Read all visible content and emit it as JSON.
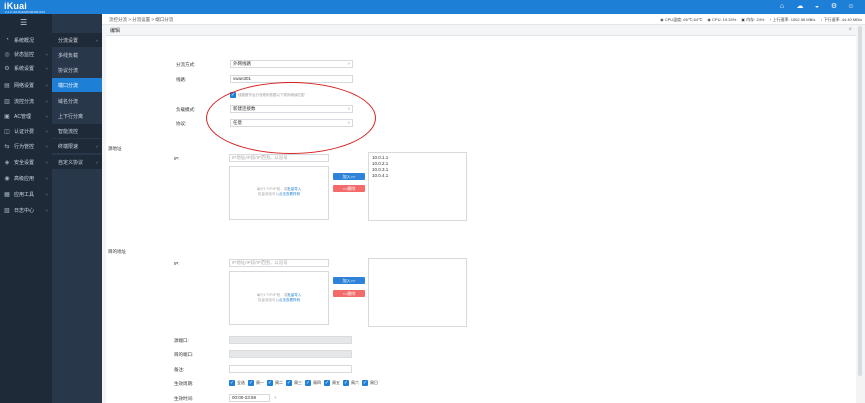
{
  "app": {
    "logo": "iKuai",
    "version": "3.4.2 x64 Build202009091019"
  },
  "topbar_icons": [
    "home-icon",
    "cloud-icon",
    "notification-icon",
    "settings-icon",
    "user-icon"
  ],
  "sidebar": {
    "items": [
      {
        "icon": "dashboard-icon",
        "glyph": "◔",
        "label": "系统概况"
      },
      {
        "icon": "monitor-icon",
        "glyph": "◎",
        "label": "状态监控",
        "chev": "˅"
      },
      {
        "icon": "gear-icon",
        "glyph": "⚙",
        "label": "系统设置",
        "chev": "˅"
      },
      {
        "icon": "network-icon",
        "glyph": "▤",
        "label": "网络设置",
        "chev": "˅"
      },
      {
        "icon": "traffic-icon",
        "glyph": "▥",
        "label": "流控分流",
        "chev": "˅"
      },
      {
        "icon": "ac-icon",
        "glyph": "▣",
        "label": "AC管理",
        "chev": "˅"
      },
      {
        "icon": "auth-icon",
        "glyph": "◫",
        "label": "认证计费",
        "chev": "˅"
      },
      {
        "icon": "behavior-icon",
        "glyph": "⇆",
        "label": "行为管控",
        "chev": "˅"
      },
      {
        "icon": "security-icon",
        "glyph": "◈",
        "label": "安全设置",
        "chev": "˅"
      },
      {
        "icon": "advanced-icon",
        "glyph": "◉",
        "label": "高级应用",
        "chev": "˅"
      },
      {
        "icon": "tools-icon",
        "glyph": "▦",
        "label": "应用工具",
        "chev": "˅"
      },
      {
        "icon": "log-icon",
        "glyph": "▧",
        "label": "日志中心",
        "chev": "˅"
      }
    ],
    "sub_items": [
      {
        "label": "分流设置",
        "type": "group",
        "chev": "˄"
      },
      {
        "label": "多线负载",
        "type": "normal"
      },
      {
        "label": "协议分流",
        "type": "normal"
      },
      {
        "label": "端口分流",
        "type": "active"
      },
      {
        "label": "域名分流",
        "type": "normal"
      },
      {
        "label": "上下行分离",
        "type": "normal"
      },
      {
        "label": "智能流控",
        "type": "group"
      },
      {
        "label": "终端限速",
        "type": "group",
        "chev": "˅"
      },
      {
        "label": "自定义协议",
        "type": "group",
        "chev": "˅"
      }
    ]
  },
  "header": {
    "breadcrumb": "流控分流 > 分流设置 > 端口分流",
    "stats": [
      {
        "icon": "cpu-temp-icon",
        "text": "CPU温度: 65℃,64℃"
      },
      {
        "icon": "cpu-icon",
        "text": "CPU: 19.33%"
      },
      {
        "icon": "memory-icon",
        "text": "内存: 24%"
      },
      {
        "icon": "upload-icon",
        "text": "上行速率: 1002.56 MB/s"
      },
      {
        "icon": "download-icon",
        "text": "下行速率: 44.40 MB/s"
      }
    ]
  },
  "panel": {
    "title": "编辑",
    "close": "×",
    "split_mode_label": "分流方式:",
    "split_mode_value": "外网线路",
    "line_label": "线路:",
    "line_value": "vwan301",
    "enable_hint": "线路断开后分流规则依据以下规则继续匹配",
    "load_mode_label": "负载模式:",
    "load_mode_value": "新建连接数",
    "protocol_label": "协议:",
    "protocol_value": "任意",
    "source_label": "源地址",
    "dest_label": "目的地址",
    "ip_label": "IP:",
    "ip_placeholder": "IP地址/IP段/IP范围，以逗号",
    "batch_hint_line1": "每行1个IP/IP段，或",
    "batch_link": "批量导入",
    "batch_hint_line2": "批量添加可以",
    "example_link": "点击查看样例",
    "add_button": "加入>>",
    "del_button": "<<删除",
    "source_list": [
      "10.0.1.1",
      "10.0.2.1",
      "10.0.3.1",
      "10.0.4.1"
    ],
    "src_port_label": "源端口:",
    "dst_port_label": "目的端口:",
    "remark_label": "备注:",
    "cycle_label": "生效周期:",
    "weekdays": [
      "全选",
      "周一",
      "周二",
      "周三",
      "周四",
      "周五",
      "周六",
      "周日"
    ],
    "time_label": "生效时间:",
    "time_value": "00:00-23:59",
    "time_add": "+"
  }
}
